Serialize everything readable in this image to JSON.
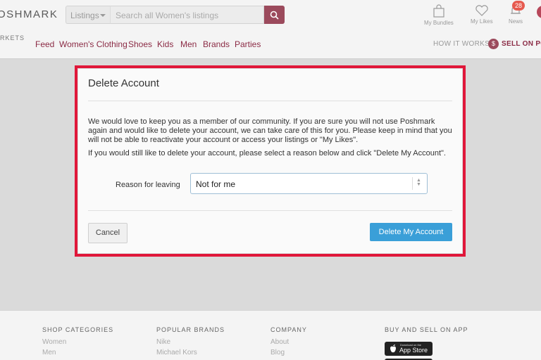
{
  "header": {
    "logo_text": "OSHMARK",
    "search_category": "Listings",
    "search_placeholder": "Search all Women's listings",
    "bundles_label": "My Bundles",
    "likes_label": "My Likes",
    "news_label": "News",
    "news_count": "28",
    "markets_label": "RKETS",
    "nav_items": [
      "Feed",
      "Women's Clothing",
      "Shoes",
      "Kids",
      "Men",
      "Brands",
      "Parties"
    ],
    "how_it_works": "HOW IT WORKS",
    "sell_icon": "$",
    "sell_label": "SELL ON POS"
  },
  "modal": {
    "title": "Delete Account",
    "paragraph1": "We would love to keep you as a member of our community. If you are sure you will not use Poshmark again and would like to delete your account, we can take care of this for you. Please keep in mind that you will not be able to reactivate your account or access your listings or \"My Likes\".",
    "paragraph2": "If you would still like to delete your account, please select a reason below and click \"Delete My Account\".",
    "reason_label": "Reason for leaving",
    "reason_value": "Not for me",
    "cancel_label": "Cancel",
    "delete_label": "Delete My Account"
  },
  "footer": {
    "columns": [
      {
        "heading": "SHOP CATEGORIES",
        "links": [
          "Women",
          "Men"
        ]
      },
      {
        "heading": "POPULAR BRANDS",
        "links": [
          "Nike",
          "Michael Kors"
        ]
      },
      {
        "heading": "COMPANY",
        "links": [
          "About",
          "Blog"
        ]
      },
      {
        "heading": "BUY AND SELL ON APP",
        "links": []
      }
    ],
    "appstore_small": "Download on the",
    "appstore_big": "App Store"
  },
  "colors": {
    "brand": "#9b4a5c",
    "nav_text": "#8b2b45",
    "highlight_border": "#e0173a",
    "primary_button": "#3a9fd8",
    "badge": "#e65a4f"
  },
  "icons": [
    "search-icon",
    "shopping-bag-icon",
    "heart-icon",
    "bell-icon",
    "dollar-icon",
    "select-arrows-icon",
    "apple-icon",
    "caret-down-icon"
  ]
}
